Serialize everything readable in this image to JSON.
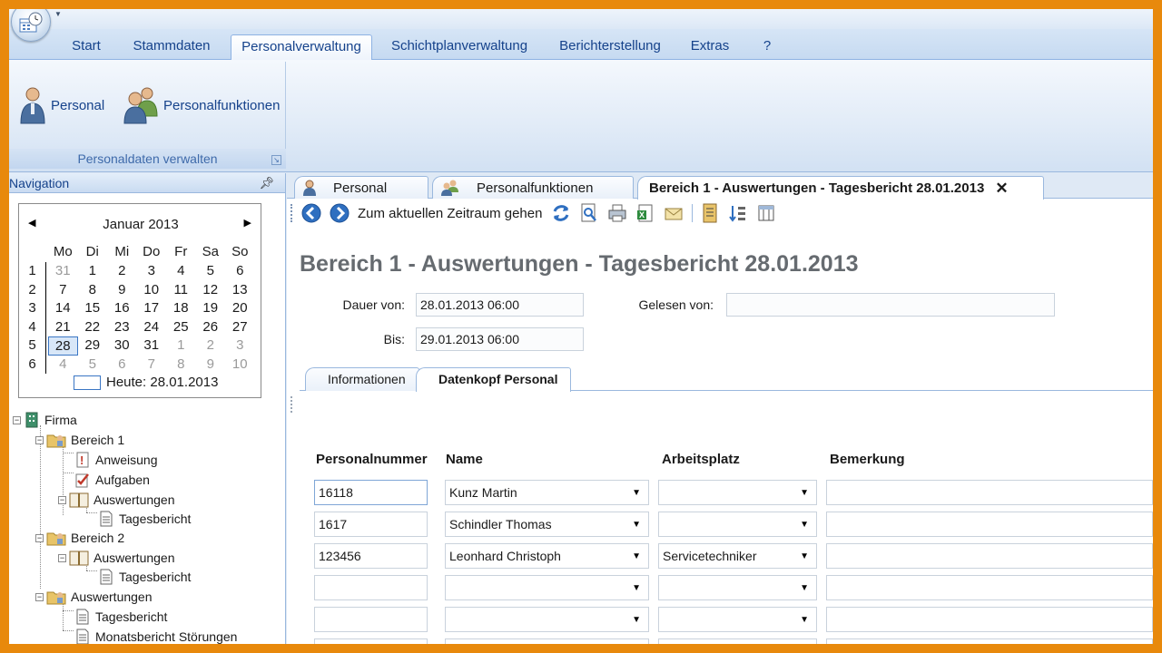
{
  "ribbon": {
    "tabs": [
      "Start",
      "Stammdaten",
      "Personalverwaltung",
      "Schichtplanverwaltung",
      "Berichterstellung",
      "Extras",
      "?"
    ],
    "active_tab": "Personalverwaltung",
    "group": {
      "buttons": [
        "Personal",
        "Personalfunktionen"
      ],
      "label": "Personaldaten verwalten"
    }
  },
  "nav": {
    "title": "Navigation",
    "calendar": {
      "month": "Januar 2013",
      "weekdays": [
        "Mo",
        "Di",
        "Mi",
        "Do",
        "Fr",
        "Sa",
        "So"
      ],
      "weeks": [
        "1",
        "2",
        "3",
        "4",
        "5",
        "6"
      ],
      "rows": [
        [
          "31",
          "1",
          "2",
          "3",
          "4",
          "5",
          "6"
        ],
        [
          "7",
          "8",
          "9",
          "10",
          "11",
          "12",
          "13"
        ],
        [
          "14",
          "15",
          "16",
          "17",
          "18",
          "19",
          "20"
        ],
        [
          "21",
          "22",
          "23",
          "24",
          "25",
          "26",
          "27"
        ],
        [
          "28",
          "29",
          "30",
          "31",
          "1",
          "2",
          "3"
        ],
        [
          "4",
          "5",
          "6",
          "7",
          "8",
          "9",
          "10"
        ]
      ],
      "today_label": "Heute: 28.01.2013"
    },
    "tree": [
      "Firma",
      "Bereich 1",
      "Anweisung",
      "Aufgaben",
      "Auswertungen",
      "Tagesbericht",
      "Bereich 2",
      "Auswertungen",
      "Tagesbericht",
      "Auswertungen",
      "Tagesbericht",
      "Monatsbericht Störungen"
    ]
  },
  "doc_tabs": [
    "Personal",
    "Personalfunktionen",
    "Bereich 1 - Auswertungen - Tagesbericht 28.01.2013"
  ],
  "toolbar": {
    "goto_label": "Zum aktuellen Zeitraum gehen"
  },
  "report": {
    "title": "Bereich 1 - Auswertungen - Tagesbericht 28.01.2013",
    "dauer_label": "Dauer von:",
    "dauer_value": "28.01.2013 06:00",
    "bis_label": "Bis:",
    "bis_value": "29.01.2013 06:00",
    "gelesen_label": "Gelesen von:",
    "gelesen_value": ""
  },
  "inner_tabs": [
    "Informationen",
    "Datenkopf Personal"
  ],
  "table": {
    "columns": [
      "Personalnummer",
      "Name",
      "Arbeitsplatz",
      "Bemerkung"
    ],
    "rows": [
      [
        "16118",
        "Kunz Martin",
        "",
        ""
      ],
      [
        "1617",
        "Schindler Thomas",
        "",
        ""
      ],
      [
        "123456",
        "Leonhard Christoph",
        "Servicetechniker",
        ""
      ],
      [
        "",
        "",
        "",
        ""
      ],
      [
        "",
        "",
        "",
        ""
      ],
      [
        "",
        "",
        "",
        ""
      ]
    ]
  },
  "colors": {
    "border": "#e8890c",
    "ribbon_text": "#15428b",
    "title_gray": "#666b70"
  }
}
